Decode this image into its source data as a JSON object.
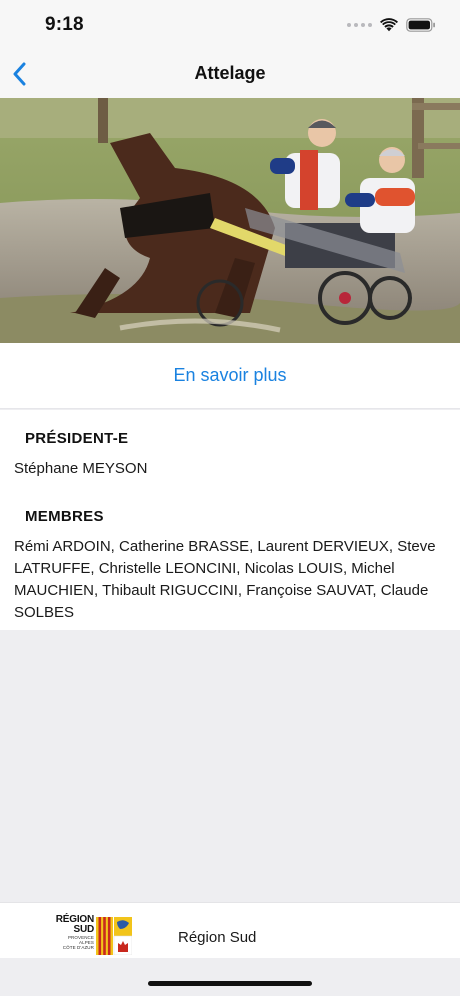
{
  "status_bar": {
    "time": "9:18"
  },
  "nav": {
    "title": "Attelage"
  },
  "hero": {
    "alt": "Attelage"
  },
  "link": {
    "label": "En savoir plus"
  },
  "president": {
    "heading": "PRÉSIDENT-E",
    "name": "Stéphane MEYSON"
  },
  "members": {
    "heading": "MEMBRES",
    "names": "Rémi ARDOIN,  Catherine BRASSE, Laurent DERVIEUX, Steve LATRUFFE, Christelle LEONCINI,  Nicolas LOUIS, Michel MAUCHIEN, Thibault RIGUCCINI, Françoise SAUVAT, Claude SOLBES"
  },
  "footer": {
    "logo_line1": "RÉGION",
    "logo_line2": "SUD",
    "logo_small1": "PROVENCE",
    "logo_small2": "ALPES",
    "logo_small3": "CÔTE D'AZUR",
    "label": "Région Sud"
  },
  "colors": {
    "accent": "#1a82e0",
    "background": "#eeeef1"
  }
}
